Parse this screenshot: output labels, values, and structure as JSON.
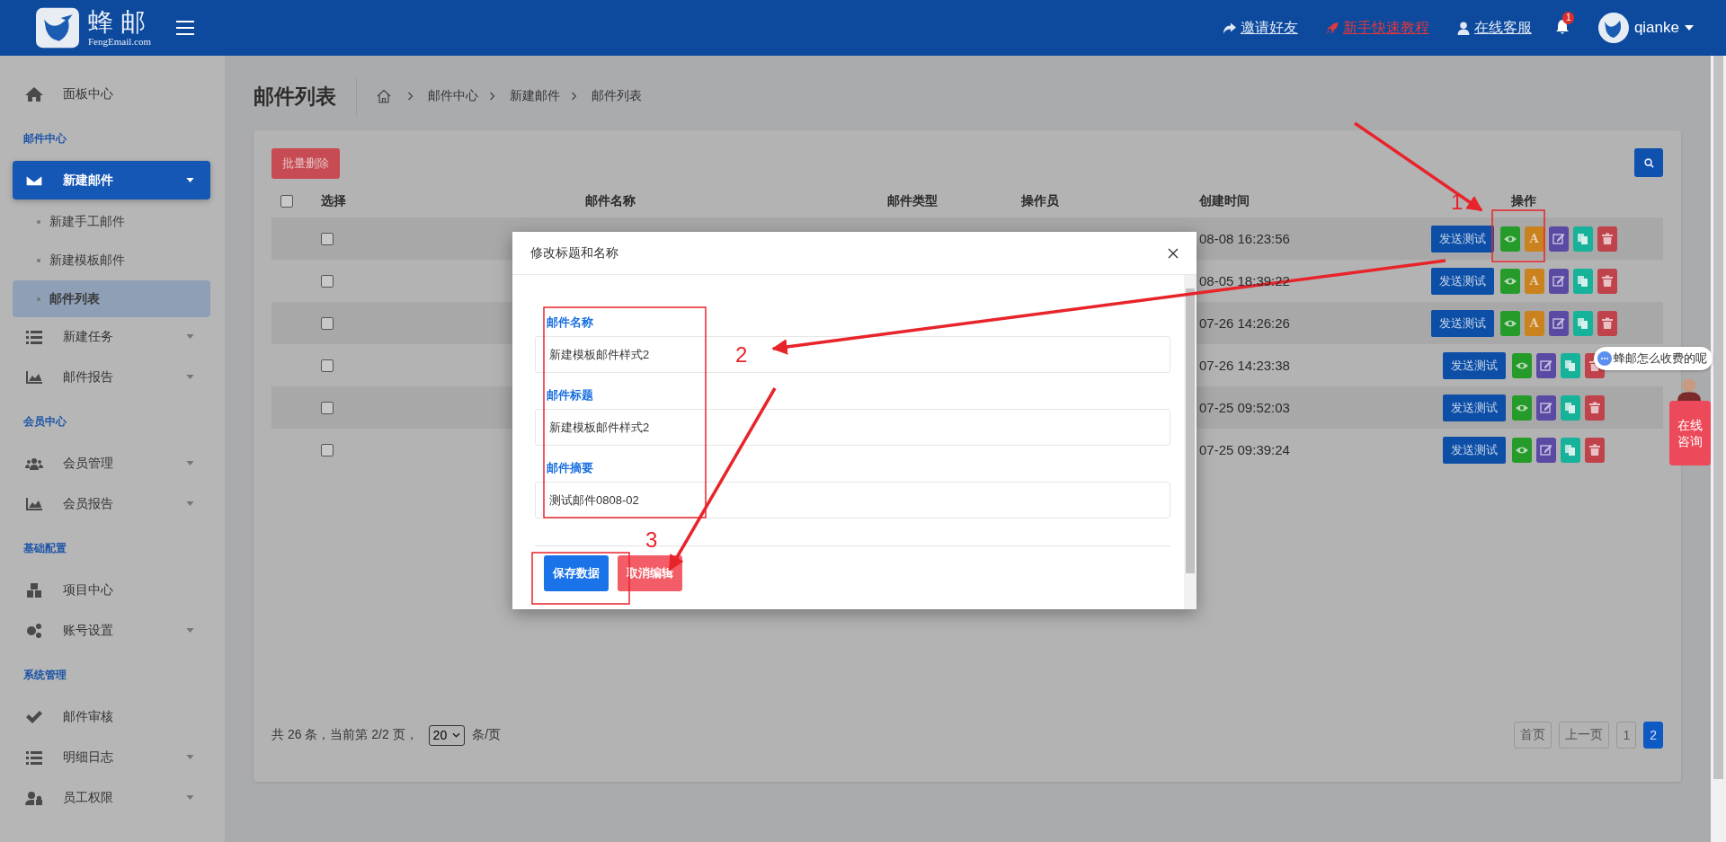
{
  "header": {
    "logo_title": "蜂邮",
    "logo_subtitle": "FengEmail.com",
    "links": [
      {
        "label": "邀请好友",
        "kind": "invite"
      },
      {
        "label": "新手快速教程",
        "kind": "tutorial"
      },
      {
        "label": "在线客服",
        "kind": "support"
      }
    ],
    "notification_count": "1",
    "user": "qianke"
  },
  "sidebar": {
    "sections": [
      {
        "items": [
          {
            "label": "面板中心",
            "selected": false,
            "has_submenu": false
          }
        ]
      },
      {
        "title": "邮件中心",
        "items": [
          {
            "label": "新建邮件",
            "selected": true,
            "has_submenu": true,
            "children": [
              {
                "label": "新建手工邮件",
                "selected": false
              },
              {
                "label": "新建模板邮件",
                "selected": false
              },
              {
                "label": "邮件列表",
                "selected": true
              }
            ]
          },
          {
            "label": "新建任务",
            "selected": false,
            "has_submenu": true
          },
          {
            "label": "邮件报告",
            "selected": false,
            "has_submenu": true
          }
        ]
      },
      {
        "title": "会员中心",
        "items": [
          {
            "label": "会员管理",
            "selected": false,
            "has_submenu": true
          },
          {
            "label": "会员报告",
            "selected": false,
            "has_submenu": true
          }
        ]
      },
      {
        "title": "基础配置",
        "items": [
          {
            "label": "项目中心",
            "selected": false,
            "has_submenu": false
          },
          {
            "label": "账号设置",
            "selected": false,
            "has_submenu": true
          }
        ]
      },
      {
        "title": "系统管理",
        "items": [
          {
            "label": "邮件审核",
            "selected": false,
            "has_submenu": false
          },
          {
            "label": "明细日志",
            "selected": false,
            "has_submenu": true
          },
          {
            "label": "员工权限",
            "selected": false,
            "has_submenu": true
          }
        ]
      }
    ]
  },
  "page": {
    "title": "邮件列表",
    "breadcrumb": [
      "邮件中心",
      "新建邮件",
      "邮件列表"
    ]
  },
  "toolbar": {
    "bulk_delete": "批量删除"
  },
  "table": {
    "select_all_checked": false,
    "columns": [
      "选择",
      "邮件名称",
      "邮件类型",
      "操作员",
      "创建时间",
      "操作"
    ],
    "rows": [
      {
        "checked": false,
        "created": "08-08 16:23:56",
        "send_label": "发送测试",
        "actions": [
          {
            "kind": "preview"
          },
          {
            "kind": "rename",
            "label": "A"
          },
          {
            "kind": "edit"
          },
          {
            "kind": "copy"
          },
          {
            "kind": "delete"
          }
        ]
      },
      {
        "checked": false,
        "created": "08-05 18:39:22",
        "send_label": "发送测试",
        "actions": [
          {
            "kind": "preview"
          },
          {
            "kind": "rename",
            "label": "A"
          },
          {
            "kind": "edit"
          },
          {
            "kind": "copy"
          },
          {
            "kind": "delete"
          }
        ]
      },
      {
        "checked": false,
        "created": "07-26 14:26:26",
        "send_label": "发送测试",
        "actions": [
          {
            "kind": "preview"
          },
          {
            "kind": "rename",
            "label": "A"
          },
          {
            "kind": "edit"
          },
          {
            "kind": "copy"
          },
          {
            "kind": "delete"
          }
        ]
      },
      {
        "checked": false,
        "created": "07-26 14:23:38",
        "send_label": "发送测试",
        "actions": [
          {
            "kind": "preview"
          },
          {
            "kind": "edit"
          },
          {
            "kind": "copy"
          },
          {
            "kind": "delete"
          }
        ]
      },
      {
        "checked": false,
        "created": "07-25 09:52:03",
        "send_label": "发送测试",
        "actions": [
          {
            "kind": "preview"
          },
          {
            "kind": "edit"
          },
          {
            "kind": "copy"
          },
          {
            "kind": "delete"
          }
        ]
      },
      {
        "checked": false,
        "created": "07-25 09:39:24",
        "send_label": "发送测试",
        "actions": [
          {
            "kind": "preview"
          },
          {
            "kind": "edit"
          },
          {
            "kind": "copy"
          },
          {
            "kind": "delete"
          }
        ]
      }
    ]
  },
  "pagination": {
    "summary": "共 26 条，当前第 2/2 页，",
    "page_size": "20",
    "unit": "条/页",
    "pages": [
      {
        "label": "首页",
        "selected": false
      },
      {
        "label": "上一页",
        "selected": false
      },
      {
        "label": "1",
        "selected": false
      },
      {
        "label": "2",
        "selected": true
      }
    ]
  },
  "dialog": {
    "title": "修改标题和名称",
    "fields": [
      {
        "label": "邮件名称",
        "value": "新建模板邮件样式2"
      },
      {
        "label": "邮件标题",
        "value": "新建模板邮件样式2"
      },
      {
        "label": "邮件摘要",
        "value": "测试邮件0808-02"
      }
    ],
    "buttons": [
      {
        "label": "保存数据",
        "kind": "primary"
      },
      {
        "label": "取消编辑",
        "kind": "danger"
      }
    ]
  },
  "chat_widget": {
    "bubble": "蜂邮怎么收费的呢",
    "consult": "在线咨询"
  },
  "annotations": [
    {
      "number": "1"
    },
    {
      "number": "2"
    },
    {
      "number": "3"
    }
  ]
}
